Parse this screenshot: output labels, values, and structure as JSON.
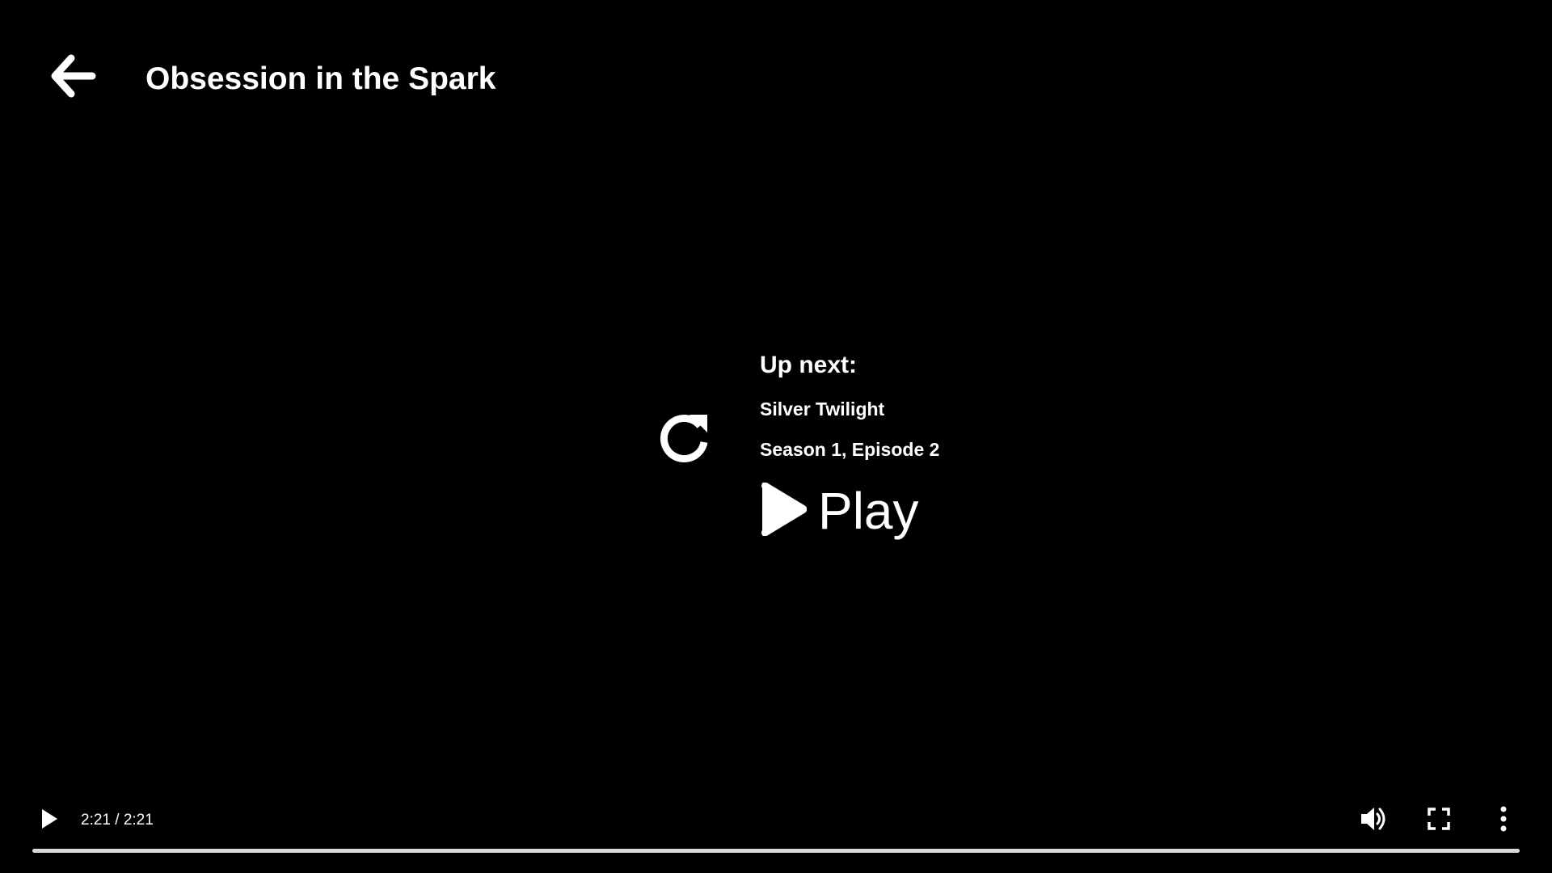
{
  "header": {
    "back_icon": "arrow-left-icon",
    "title": "Obsession in the Spark"
  },
  "up_next": {
    "replay_icon": "replay-icon",
    "label": "Up next:",
    "episode_title": "Silver Twilight",
    "episode_meta": "Season 1, Episode 2",
    "play_icon": "play-icon",
    "play_label": "Play"
  },
  "controls": {
    "play_icon": "play-icon",
    "time_display": "2:21 / 2:21",
    "volume_icon": "volume-icon",
    "fullscreen_icon": "fullscreen-icon",
    "more_icon": "more-vertical-icon",
    "progress_fraction": 1.0
  },
  "colors": {
    "background": "#000000",
    "text": "#ffffff",
    "progress_fill": "#d9d9d9",
    "progress_track": "#5a5a5a"
  }
}
